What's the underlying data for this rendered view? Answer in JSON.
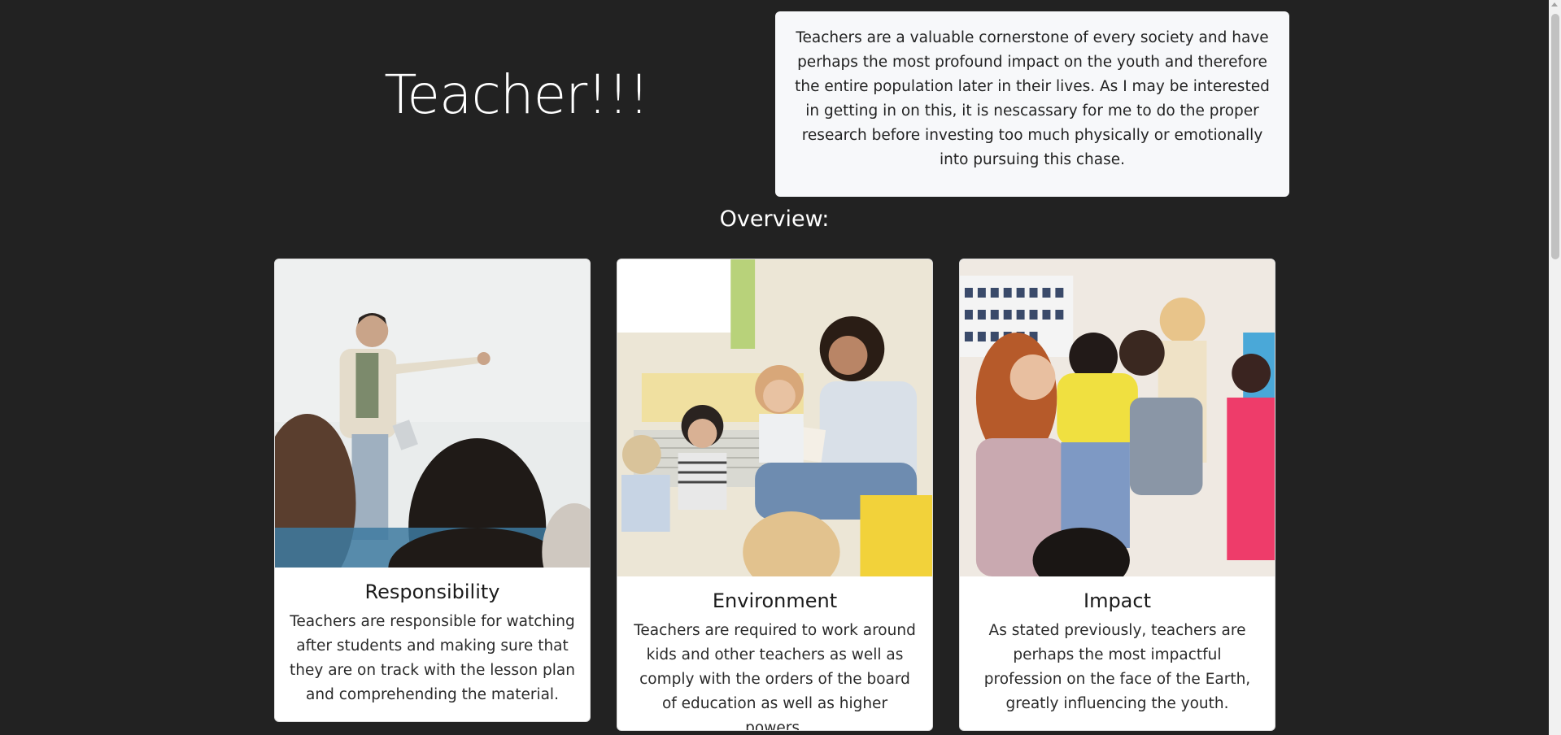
{
  "hero": {
    "title": "Teacher!!!"
  },
  "intro": {
    "text": "Teachers are a valuable cornerstone of every society and have perhaps the most profound impact on the youth and therefore the entire population later in their lives. As I may be interested in getting in on this, it is nescassary for me to do the proper research before investing too much physically or emotionally into pursuing this chase."
  },
  "overview": {
    "heading": "Overview:",
    "cards": [
      {
        "title": "Responsibility",
        "text": "Teachers are responsible for watching after students and making sure that they are on track with the lesson plan and comprehending the material."
      },
      {
        "title": "Environment",
        "text": "Teachers are required to work around kids and other teachers as well as comply with the orders of the board of education as well as higher powers."
      },
      {
        "title": "Impact",
        "text": "As stated previously, teachers are perhaps the most impactful profession on the face of the Earth, greatly influencing the youth."
      }
    ]
  },
  "colors": {
    "page_background": "#222222",
    "card_background": "#ffffff",
    "intro_background": "#f7f8fa"
  }
}
